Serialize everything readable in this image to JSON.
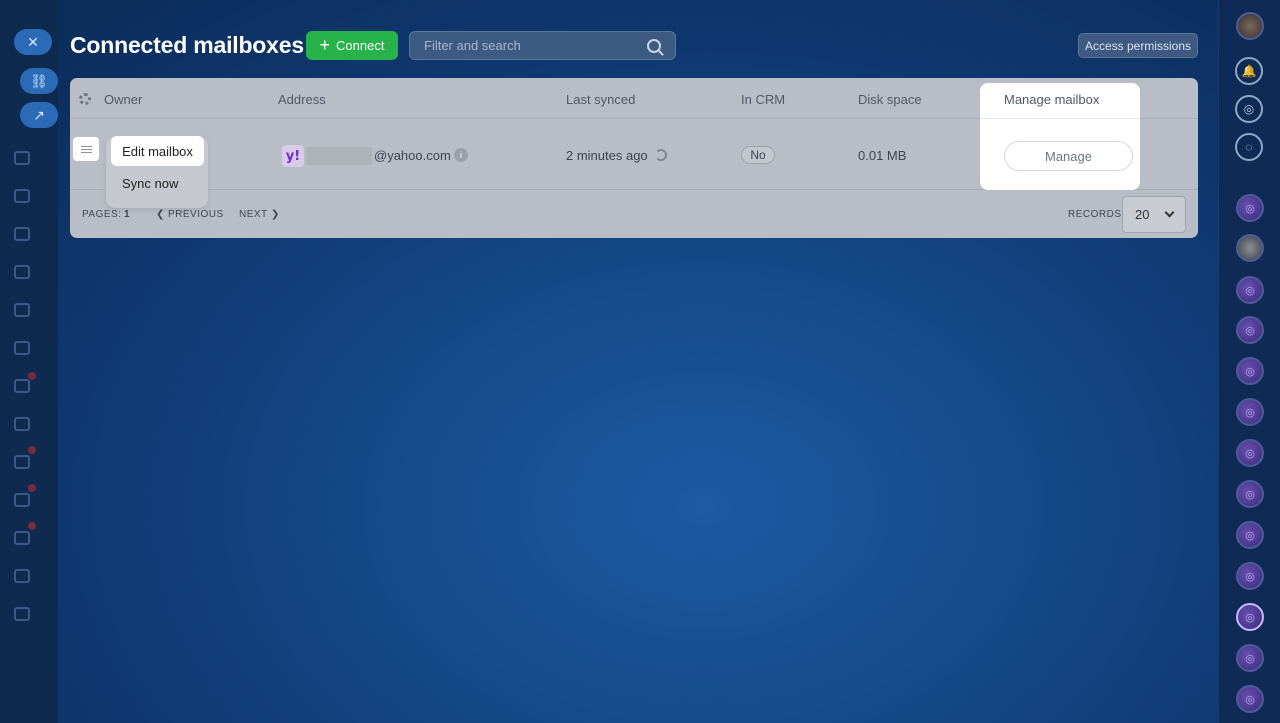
{
  "header": {
    "title": "Connected mailboxes",
    "connect_label": "Connect",
    "search_placeholder": "Filter and search",
    "access_permissions_label": "Access permissions"
  },
  "grid": {
    "columns": [
      "Owner",
      "Address",
      "Last synced",
      "In CRM",
      "Disk space",
      "Manage mailbox"
    ],
    "rows": [
      {
        "address": "@yahoo.com",
        "last_synced": "2 minutes ago",
        "in_crm": "No",
        "disk_space": "0.01 MB",
        "manage_label": "Manage"
      }
    ]
  },
  "row_menu": {
    "items": [
      "Edit mailbox",
      "Sync now"
    ]
  },
  "pagination": {
    "pages_label": "PAGES:",
    "pages_value": "1",
    "previous_label": "PREVIOUS",
    "next_label": "NEXT",
    "records_label": "RECORDS:",
    "records_value": "20"
  },
  "colors": {
    "connect_green": "#27b24a",
    "yahoo_purple": "#6b2fc7"
  },
  "icons": [
    "search-icon",
    "gear-icon",
    "menu-icon",
    "yahoo-logo",
    "info-icon",
    "sync-icon",
    "chevron-left-icon",
    "chevron-right-icon",
    "chevron-down-icon",
    "bell-icon",
    "close-icon"
  ]
}
